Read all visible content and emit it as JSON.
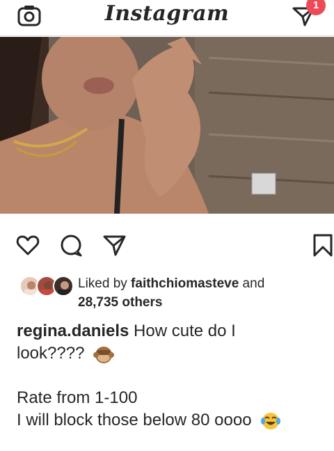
{
  "header": {
    "logo_text": "Instagram",
    "camera_icon": "camera-icon",
    "direct_icon": "paper-plane-icon",
    "direct_badge": "1",
    "badge_color": "#ed4956"
  },
  "post": {
    "image": "photo",
    "actions": {
      "like_icon": "heart-icon",
      "comment_icon": "comment-icon",
      "share_icon": "paper-plane-icon",
      "save_icon": "bookmark-icon"
    },
    "likes": {
      "prefix": "Liked by ",
      "user": "faithchiomasteve",
      "connector": " and",
      "count": "28,735 others"
    },
    "caption": {
      "username": "regina.daniels",
      "line1": " How cute do I",
      "line2": "look????",
      "line3": "Rate from 1-100",
      "line4": "I will block those below 80 oooo"
    }
  }
}
